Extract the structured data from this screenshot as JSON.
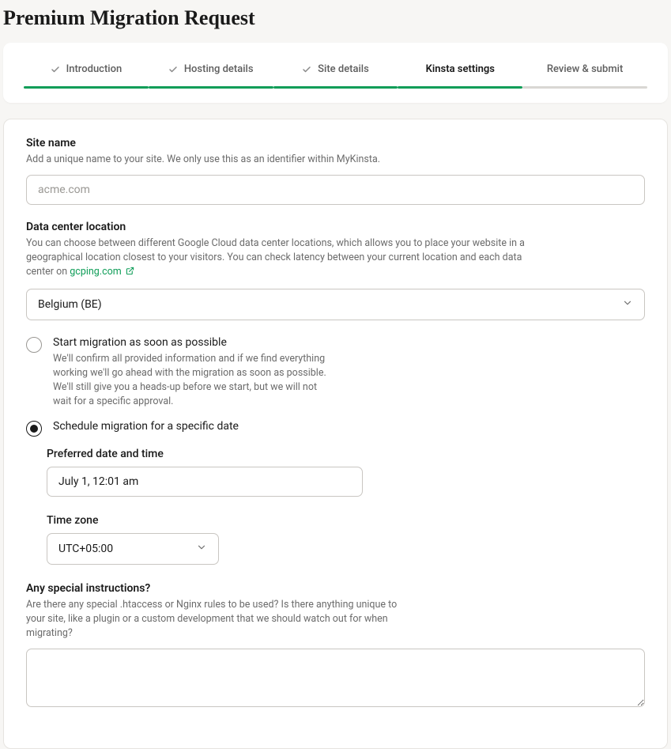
{
  "title": "Premium Migration Request",
  "steps": [
    {
      "label": "Introduction",
      "state": "done"
    },
    {
      "label": "Hosting details",
      "state": "done"
    },
    {
      "label": "Site details",
      "state": "done"
    },
    {
      "label": "Kinsta settings",
      "state": "current"
    },
    {
      "label": "Review & submit",
      "state": "pending"
    }
  ],
  "siteName": {
    "label": "Site name",
    "desc": "Add a unique name to your site. We only use this as an identifier within MyKinsta.",
    "placeholder": "acme.com",
    "value": ""
  },
  "dataCenter": {
    "label": "Data center location",
    "desc_before_link": "You can choose between different Google Cloud data center locations, which allows you to place your website in a geographical location closest to your visitors. You can check latency between your current location and each data center on ",
    "link_text": "gcping.com",
    "selected": "Belgium (BE)"
  },
  "migration": {
    "optionA": {
      "title": "Start migration as soon as possible",
      "desc": "We'll confirm all provided information and if we find everything working we'll go ahead with the migration as soon as possible. We'll still give you a heads-up before we start, but we will not wait for a specific approval."
    },
    "optionB": {
      "title": "Schedule migration for a specific date"
    },
    "selected": "b",
    "preferred": {
      "label": "Preferred date and time",
      "value": "July 1, 12:01 am"
    },
    "timezone": {
      "label": "Time zone",
      "value": "UTC+05:00"
    }
  },
  "special": {
    "label": "Any special instructions?",
    "desc": "Are there any special .htaccess or Nginx rules to be used? Is there anything unique to your site, like a plugin or a custom development that we should watch out for when migrating?",
    "value": ""
  }
}
